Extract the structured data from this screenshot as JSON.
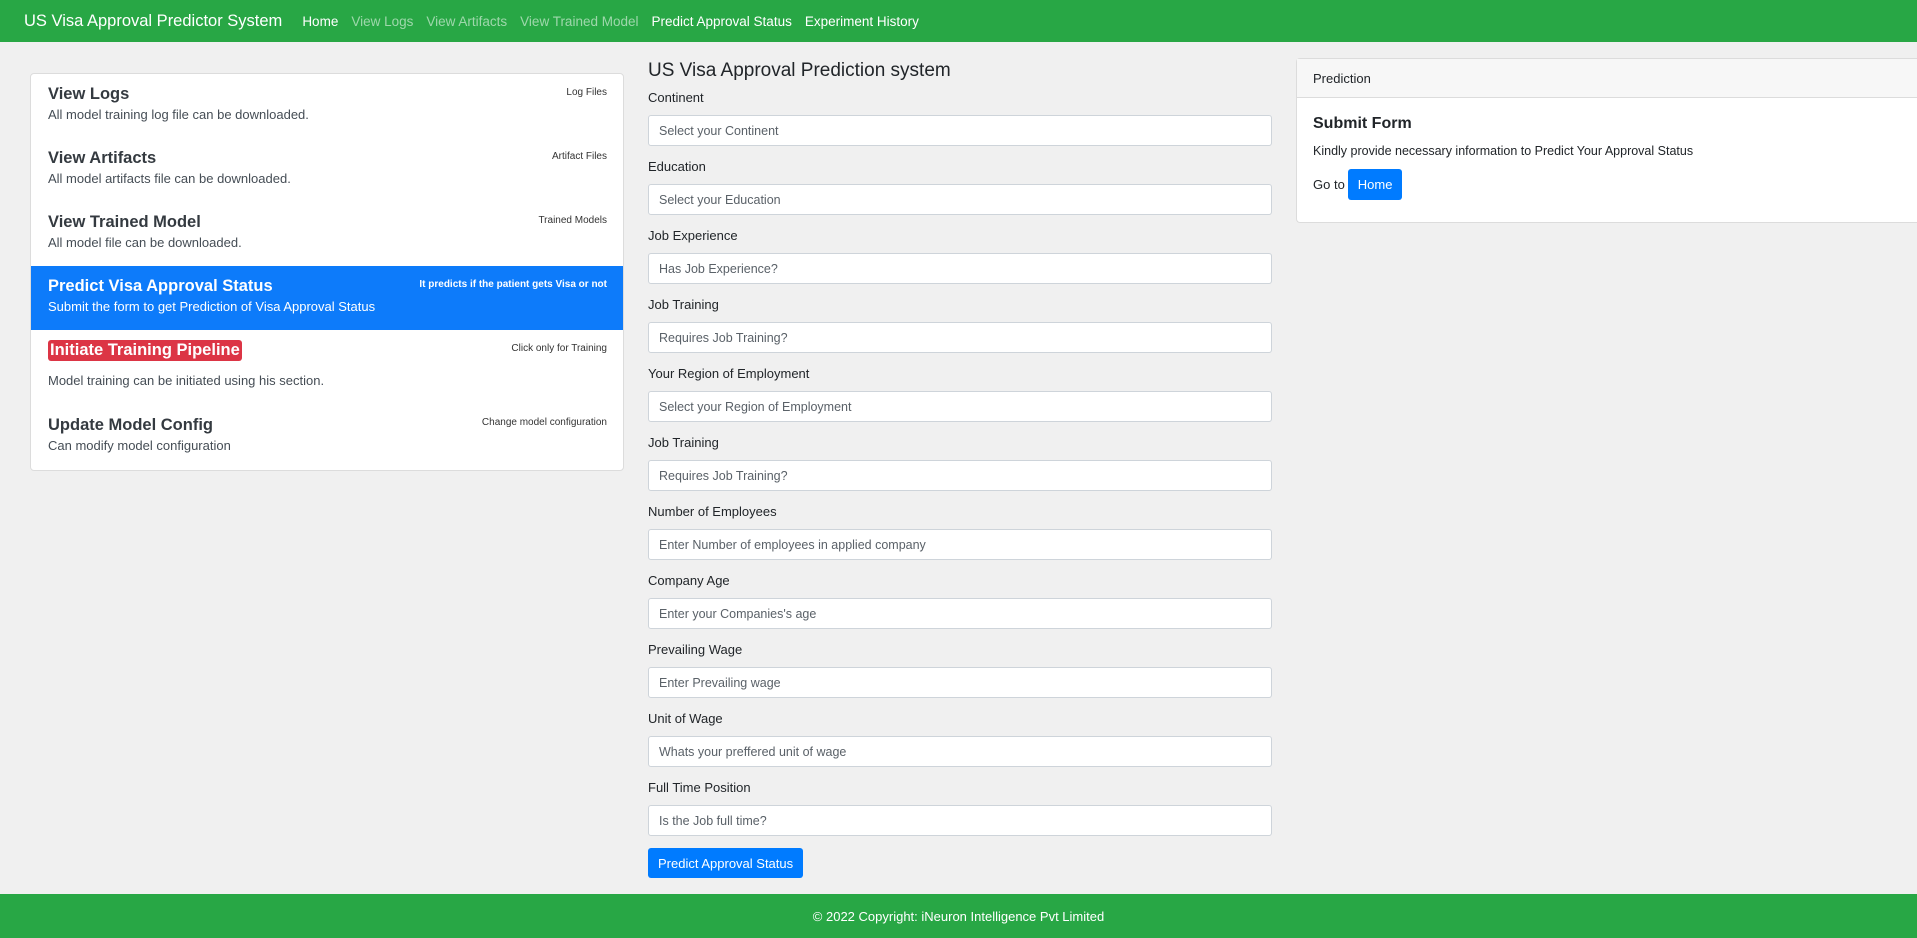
{
  "navbar": {
    "brand": "US Visa Approval Predictor System",
    "links": [
      {
        "label": "Home",
        "state": "active"
      },
      {
        "label": "View Logs",
        "state": "muted"
      },
      {
        "label": "View Artifacts",
        "state": "muted"
      },
      {
        "label": "View Trained Model",
        "state": "muted"
      },
      {
        "label": "Predict Approval Status",
        "state": "active"
      },
      {
        "label": "Experiment History",
        "state": "active"
      }
    ]
  },
  "sidebar": {
    "items": [
      {
        "title": "View Logs",
        "description": "All model training log file can be downloaded.",
        "tag": "Log Files"
      },
      {
        "title": "View Artifacts",
        "description": "All model artifacts file can be downloaded.",
        "tag": "Artifact Files"
      },
      {
        "title": "View Trained Model",
        "description": "All model file can be downloaded.",
        "tag": "Trained Models"
      },
      {
        "title": "Predict Visa Approval Status",
        "description": "Submit the form to get Prediction of Visa Approval Status",
        "tag": "It predicts if the patient gets Visa or not"
      },
      {
        "title": "Initiate Training Pipeline",
        "description": "Model training can be initiated using his section.",
        "tag": "Click only for Training"
      },
      {
        "title": "Update Model Config",
        "description": "Can modify model configuration",
        "tag": "Change model configuration"
      }
    ]
  },
  "form": {
    "title": "US Visa Approval Prediction system",
    "fields": [
      {
        "label": "Continent",
        "placeholder": "Select your Continent"
      },
      {
        "label": "Education",
        "placeholder": "Select your Education"
      },
      {
        "label": "Job Experience",
        "placeholder": "Has Job Experience?"
      },
      {
        "label": "Job Training",
        "placeholder": "Requires Job Training?"
      },
      {
        "label": "Your Region of Employment",
        "placeholder": "Select your Region of Employment"
      },
      {
        "label": "Job Training",
        "placeholder": "Requires Job Training?"
      },
      {
        "label": "Number of Employees",
        "placeholder": "Enter Number of employees in applied company"
      },
      {
        "label": "Company Age",
        "placeholder": "Enter your Companies's age"
      },
      {
        "label": "Prevailing Wage",
        "placeholder": "Enter Prevailing wage"
      },
      {
        "label": "Unit of Wage",
        "placeholder": "Whats your preffered unit of wage"
      },
      {
        "label": "Full Time Position",
        "placeholder": "Is the Job full time?"
      }
    ],
    "submit_label": "Predict Approval Status"
  },
  "prediction_card": {
    "header": "Prediction",
    "title": "Submit Form",
    "text": "Kindly provide necessary information to Predict Your Approval Status",
    "goto_text": "Go to",
    "home_button": "Home"
  },
  "footer": {
    "text": "© 2022 Copyright: iNeuron Intelligence Pvt Limited"
  },
  "colors": {
    "navbar_bg": "#28a745",
    "primary": "#007bff",
    "danger": "#dc3545",
    "page_bg": "#f0f0f0"
  }
}
